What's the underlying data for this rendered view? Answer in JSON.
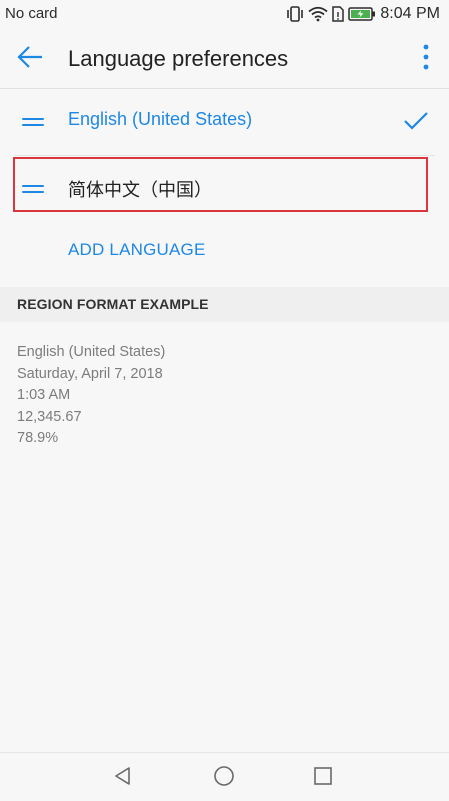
{
  "status_bar": {
    "carrier": "No card",
    "time": "8:04 PM",
    "icons": [
      "vibrate-icon",
      "wifi-icon",
      "sim-icon",
      "battery-charging-icon"
    ]
  },
  "header": {
    "title": "Language preferences",
    "back_icon": "arrow-left-icon",
    "more_icon": "more-vertical-icon"
  },
  "languages": [
    {
      "label": "English (United States)",
      "selected": true
    },
    {
      "label": "简体中文（中国）",
      "selected": false
    }
  ],
  "add_language_label": "ADD LANGUAGE",
  "region_section": {
    "title": "REGION FORMAT EXAMPLE",
    "lines": [
      "English (United States)",
      "Saturday, April 7, 2018",
      "1:03 AM",
      "12,345.67",
      "78.9%"
    ]
  },
  "nav_bar": {
    "buttons": [
      "back-triangle-icon",
      "home-circle-icon",
      "recents-square-icon"
    ]
  },
  "colors": {
    "accent": "#1e88e5",
    "highlight": "#d9363e",
    "background": "#f7f7f7"
  }
}
